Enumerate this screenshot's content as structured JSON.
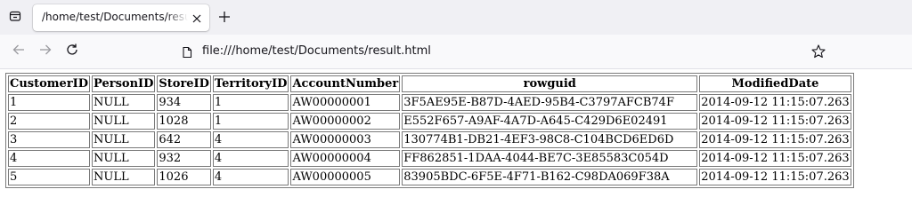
{
  "browser": {
    "tab": {
      "title": "/home/test/Documents/result.html",
      "icons": {
        "tab_list": "tab-list-icon",
        "close": "close-icon",
        "new_tab": "plus-icon"
      }
    },
    "nav": {
      "icons": {
        "back": "arrow-left-icon",
        "forward": "arrow-right-icon",
        "reload": "reload-icon"
      }
    },
    "urlbar": {
      "url": "file:///home/test/Documents/result.html",
      "icons": {
        "page": "page-icon",
        "bookmark": "star-icon"
      }
    },
    "colors": {
      "tabstrip_bg": "#f0f0f4",
      "navbar_bg": "#f9f9fb",
      "text": "#15141a"
    }
  },
  "table": {
    "headers": [
      "CustomerID",
      "PersonID",
      "StoreID",
      "TerritoryID",
      "AccountNumber",
      "rowguid",
      "ModifiedDate"
    ],
    "rows": [
      [
        "1",
        "NULL",
        "934",
        "1",
        "AW00000001",
        "3F5AE95E-B87D-4AED-95B4-C3797AFCB74F",
        "2014-09-12 11:15:07.263"
      ],
      [
        "2",
        "NULL",
        "1028",
        "1",
        "AW00000002",
        "E552F657-A9AF-4A7D-A645-C429D6E02491",
        "2014-09-12 11:15:07.263"
      ],
      [
        "3",
        "NULL",
        "642",
        "4",
        "AW00000003",
        "130774B1-DB21-4EF3-98C8-C104BCD6ED6D",
        "2014-09-12 11:15:07.263"
      ],
      [
        "4",
        "NULL",
        "932",
        "4",
        "AW00000004",
        "FF862851-1DAA-4044-BE7C-3E85583C054D",
        "2014-09-12 11:15:07.263"
      ],
      [
        "5",
        "NULL",
        "1026",
        "4",
        "AW00000005",
        "83905BDC-6F5E-4F71-B162-C98DA069F38A",
        "2014-09-12 11:15:07.263"
      ]
    ]
  }
}
